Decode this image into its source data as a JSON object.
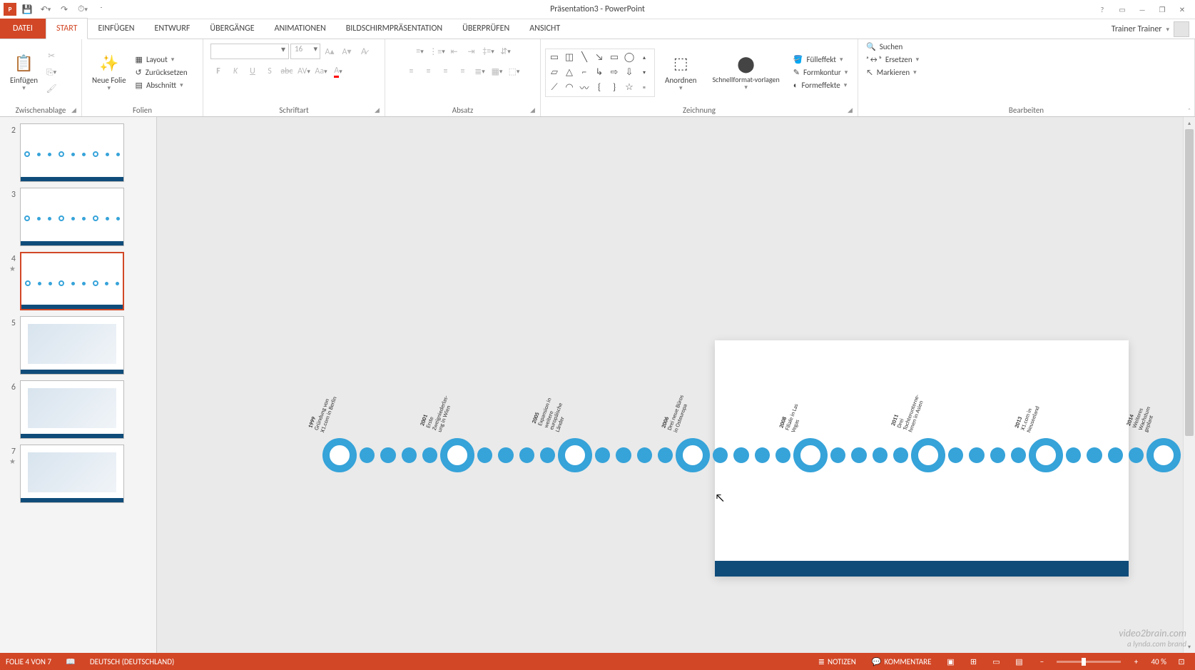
{
  "title": "Präsentation3 - PowerPoint",
  "user": "Trainer Trainer",
  "qat": {
    "save": "💾",
    "undo": "↶",
    "redo": "↷",
    "start": "⏱"
  },
  "tabs": {
    "file": "DATEI",
    "start": "START",
    "einfuegen": "EINFÜGEN",
    "entwurf": "ENTWURF",
    "uebergaenge": "ÜBERGÄNGE",
    "animationen": "ANIMATIONEN",
    "bildschirm": "BILDSCHIRMPRÄSENTATION",
    "ueberpruefen": "ÜBERPRÜFEN",
    "ansicht": "ANSICHT"
  },
  "ribbon": {
    "clipboard": {
      "label": "Zwischenablage",
      "paste": "Einfügen"
    },
    "slides": {
      "label": "Folien",
      "new": "Neue Folie",
      "layout": "Layout",
      "reset": "Zurücksetzen",
      "section": "Abschnitt"
    },
    "font": {
      "label": "Schriftart",
      "size": "16"
    },
    "paragraph": {
      "label": "Absatz"
    },
    "drawing": {
      "label": "Zeichnung",
      "arrange": "Anordnen",
      "quick": "Schnellformat-vorlagen",
      "fill": "Fülleffekt",
      "outline": "Formkontur",
      "effects": "Formeffekte"
    },
    "editing": {
      "label": "Bearbeiten",
      "find": "Suchen",
      "replace": "Ersetzen",
      "select": "Markieren"
    }
  },
  "thumbs": [
    {
      "n": "2"
    },
    {
      "n": "3"
    },
    {
      "n": "4",
      "sel": true,
      "star": true
    },
    {
      "n": "5"
    },
    {
      "n": "6"
    },
    {
      "n": "7",
      "star": true
    }
  ],
  "timeline": [
    {
      "year": "1999",
      "text": "Gründung von\nX1.com in Berlin"
    },
    {
      "year": "2001",
      "text": "Erste\nZweigniederlas-\nung in Wien"
    },
    {
      "year": "2005",
      "text": "Expansion in\nweitere\neuropäische\nLänder"
    },
    {
      "year": "2006",
      "text": "Drei neue Büros\nin Osteuropa"
    },
    {
      "year": "2008",
      "text": "Filiale in Las\nVegas"
    },
    {
      "year": "2011",
      "text": "Drei\nTochterunterne-\nhmen in Asien"
    },
    {
      "year": "2013",
      "text": "X1.com in\nNeuseeland"
    },
    {
      "year": "2014",
      "text": "Weiteres\nWachstum\ngeplant"
    }
  ],
  "status": {
    "slide": "FOLIE 4 VON 7",
    "lang": "DEUTSCH (DEUTSCHLAND)",
    "notes": "NOTIZEN",
    "comments": "KOMMENTARE",
    "zoom": "40 %"
  },
  "watermark": {
    "l1": "video2brain.com",
    "l2": "a lynda.com brand"
  }
}
